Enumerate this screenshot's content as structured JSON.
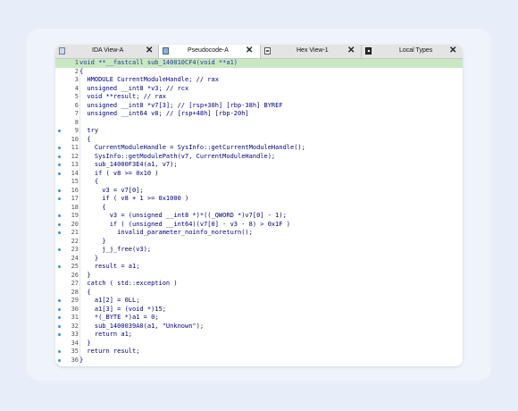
{
  "tabs": [
    {
      "label": "IDA View-A",
      "icon": "ida-view-icon",
      "close": "✕",
      "active": false
    },
    {
      "label": "Pseudocode-A",
      "icon": "pseudocode-icon",
      "close": "✕",
      "active": true
    },
    {
      "label": "Hex View-1",
      "icon": "hex-view-icon",
      "close": "✕",
      "active": false
    },
    {
      "label": "Local Types",
      "icon": "local-types-icon",
      "close": "✕",
      "active": false
    }
  ],
  "colors": {
    "accent": "#3d8fd6",
    "highlight": "#c8e8c2",
    "code_text": "#000080"
  },
  "code": [
    {
      "n": "1",
      "dot": false,
      "hl": true,
      "text": "void **__fastcall sub_140010CF4(void **a1)"
    },
    {
      "n": "2",
      "dot": false,
      "hl": false,
      "text": "{"
    },
    {
      "n": "3",
      "dot": false,
      "hl": false,
      "text": "  HMODULE CurrentModuleHandle; // rax"
    },
    {
      "n": "4",
      "dot": false,
      "hl": false,
      "text": "  unsigned __int8 *v3; // rcx"
    },
    {
      "n": "5",
      "dot": false,
      "hl": false,
      "text": "  void **result; // rax"
    },
    {
      "n": "6",
      "dot": false,
      "hl": false,
      "text": "  unsigned __int8 *v7[3]; // [rsp+30h] [rbp-38h] BYREF"
    },
    {
      "n": "7",
      "dot": false,
      "hl": false,
      "text": "  unsigned __int64 v8; // [rsp+48h] [rbp-20h]"
    },
    {
      "n": "8",
      "dot": false,
      "hl": false,
      "text": ""
    },
    {
      "n": "9",
      "dot": true,
      "hl": false,
      "text": "  try"
    },
    {
      "n": "10",
      "dot": false,
      "hl": false,
      "text": "  {"
    },
    {
      "n": "11",
      "dot": true,
      "hl": false,
      "text": "    CurrentModuleHandle = SysInfo::getCurrentModuleHandle();"
    },
    {
      "n": "12",
      "dot": true,
      "hl": false,
      "text": "    SysInfo::getModulePath(v7, CurrentModuleHandle);"
    },
    {
      "n": "13",
      "dot": true,
      "hl": false,
      "text": "    sub_14000F3E4(a1, v7);"
    },
    {
      "n": "14",
      "dot": true,
      "hl": false,
      "text": "    if ( v8 >= 0x10 )"
    },
    {
      "n": "15",
      "dot": false,
      "hl": false,
      "text": "    {"
    },
    {
      "n": "16",
      "dot": true,
      "hl": false,
      "text": "      v3 = v7[0];"
    },
    {
      "n": "17",
      "dot": true,
      "hl": false,
      "text": "      if ( v8 + 1 >= 0x1000 )"
    },
    {
      "n": "18",
      "dot": false,
      "hl": false,
      "text": "      {"
    },
    {
      "n": "19",
      "dot": true,
      "hl": false,
      "text": "        v3 = (unsigned __int8 *)*((_QWORD *)v7[0] - 1);"
    },
    {
      "n": "20",
      "dot": true,
      "hl": false,
      "text": "        if ( (unsigned __int64)(v7[0] - v3 - 8) > 0x1F )"
    },
    {
      "n": "21",
      "dot": true,
      "hl": false,
      "text": "          invalid_parameter_noinfo_noreturn();"
    },
    {
      "n": "22",
      "dot": false,
      "hl": false,
      "text": "      }"
    },
    {
      "n": "23",
      "dot": true,
      "hl": false,
      "text": "      j_j_free(v3);"
    },
    {
      "n": "24",
      "dot": false,
      "hl": false,
      "text": "    }"
    },
    {
      "n": "25",
      "dot": true,
      "hl": false,
      "text": "    result = a1;"
    },
    {
      "n": "26",
      "dot": false,
      "hl": false,
      "text": "  }"
    },
    {
      "n": "27",
      "dot": false,
      "hl": false,
      "text": "  catch ( std::exception )"
    },
    {
      "n": "28",
      "dot": false,
      "hl": false,
      "text": "  {"
    },
    {
      "n": "29",
      "dot": true,
      "hl": false,
      "text": "    a1[2] = 0LL;"
    },
    {
      "n": "30",
      "dot": true,
      "hl": false,
      "text": "    a1[3] = (void *)15;"
    },
    {
      "n": "31",
      "dot": true,
      "hl": false,
      "text": "    *(_BYTE *)a1 = 0;"
    },
    {
      "n": "32",
      "dot": true,
      "hl": false,
      "text": "    sub_1400039A0(a1, \"Unknown\");"
    },
    {
      "n": "33",
      "dot": true,
      "hl": false,
      "text": "    return a1;"
    },
    {
      "n": "34",
      "dot": false,
      "hl": false,
      "text": "  }"
    },
    {
      "n": "35",
      "dot": true,
      "hl": false,
      "text": "  return result;"
    },
    {
      "n": "36",
      "dot": true,
      "hl": false,
      "text": "}"
    }
  ]
}
